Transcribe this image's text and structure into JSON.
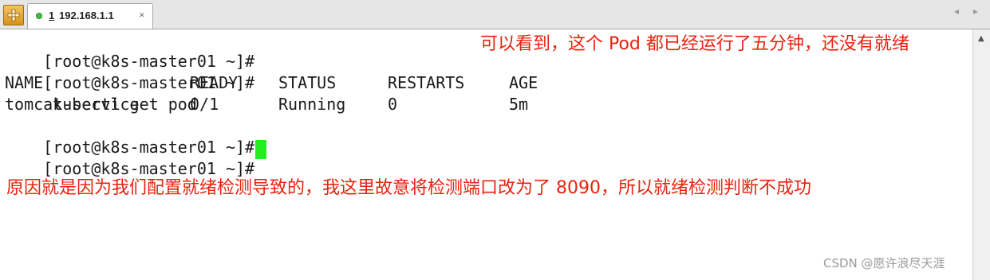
{
  "tab": {
    "number": "1",
    "title": "192.168.1.1",
    "close": "×"
  },
  "nav": {
    "prev": "◂",
    "next": "▸"
  },
  "terminal": {
    "lines": [
      {
        "prompt": "[root@k8s-master01 ~]#",
        "command": ""
      },
      {
        "prompt": "[root@k8s-master01 ~]#",
        "command": "kubectl get pod"
      }
    ],
    "table": {
      "headers": [
        "NAME",
        "READY",
        "STATUS",
        "RESTARTS",
        "AGE"
      ],
      "rows": [
        [
          "tomcat-service",
          "0/1",
          "Running",
          "0",
          "5m"
        ]
      ]
    },
    "after": [
      {
        "prompt": "[root@k8s-master01 ~]#",
        "command": ""
      },
      {
        "prompt": "[root@k8s-master01 ~]#",
        "command": ""
      }
    ]
  },
  "annotations": {
    "top": "可以看到，这个 Pod 都已经运行了五分钟，还没有就绪",
    "bottom": "原因就是因为我们配置就绪检测导致的，我这里故意将检测端口改为了 8090，所以就绪检测判断不成功"
  },
  "watermark": "CSDN @愿许浪尽天涯",
  "colors": {
    "cursor": "#22ee22",
    "annotation": "#e8220f"
  }
}
